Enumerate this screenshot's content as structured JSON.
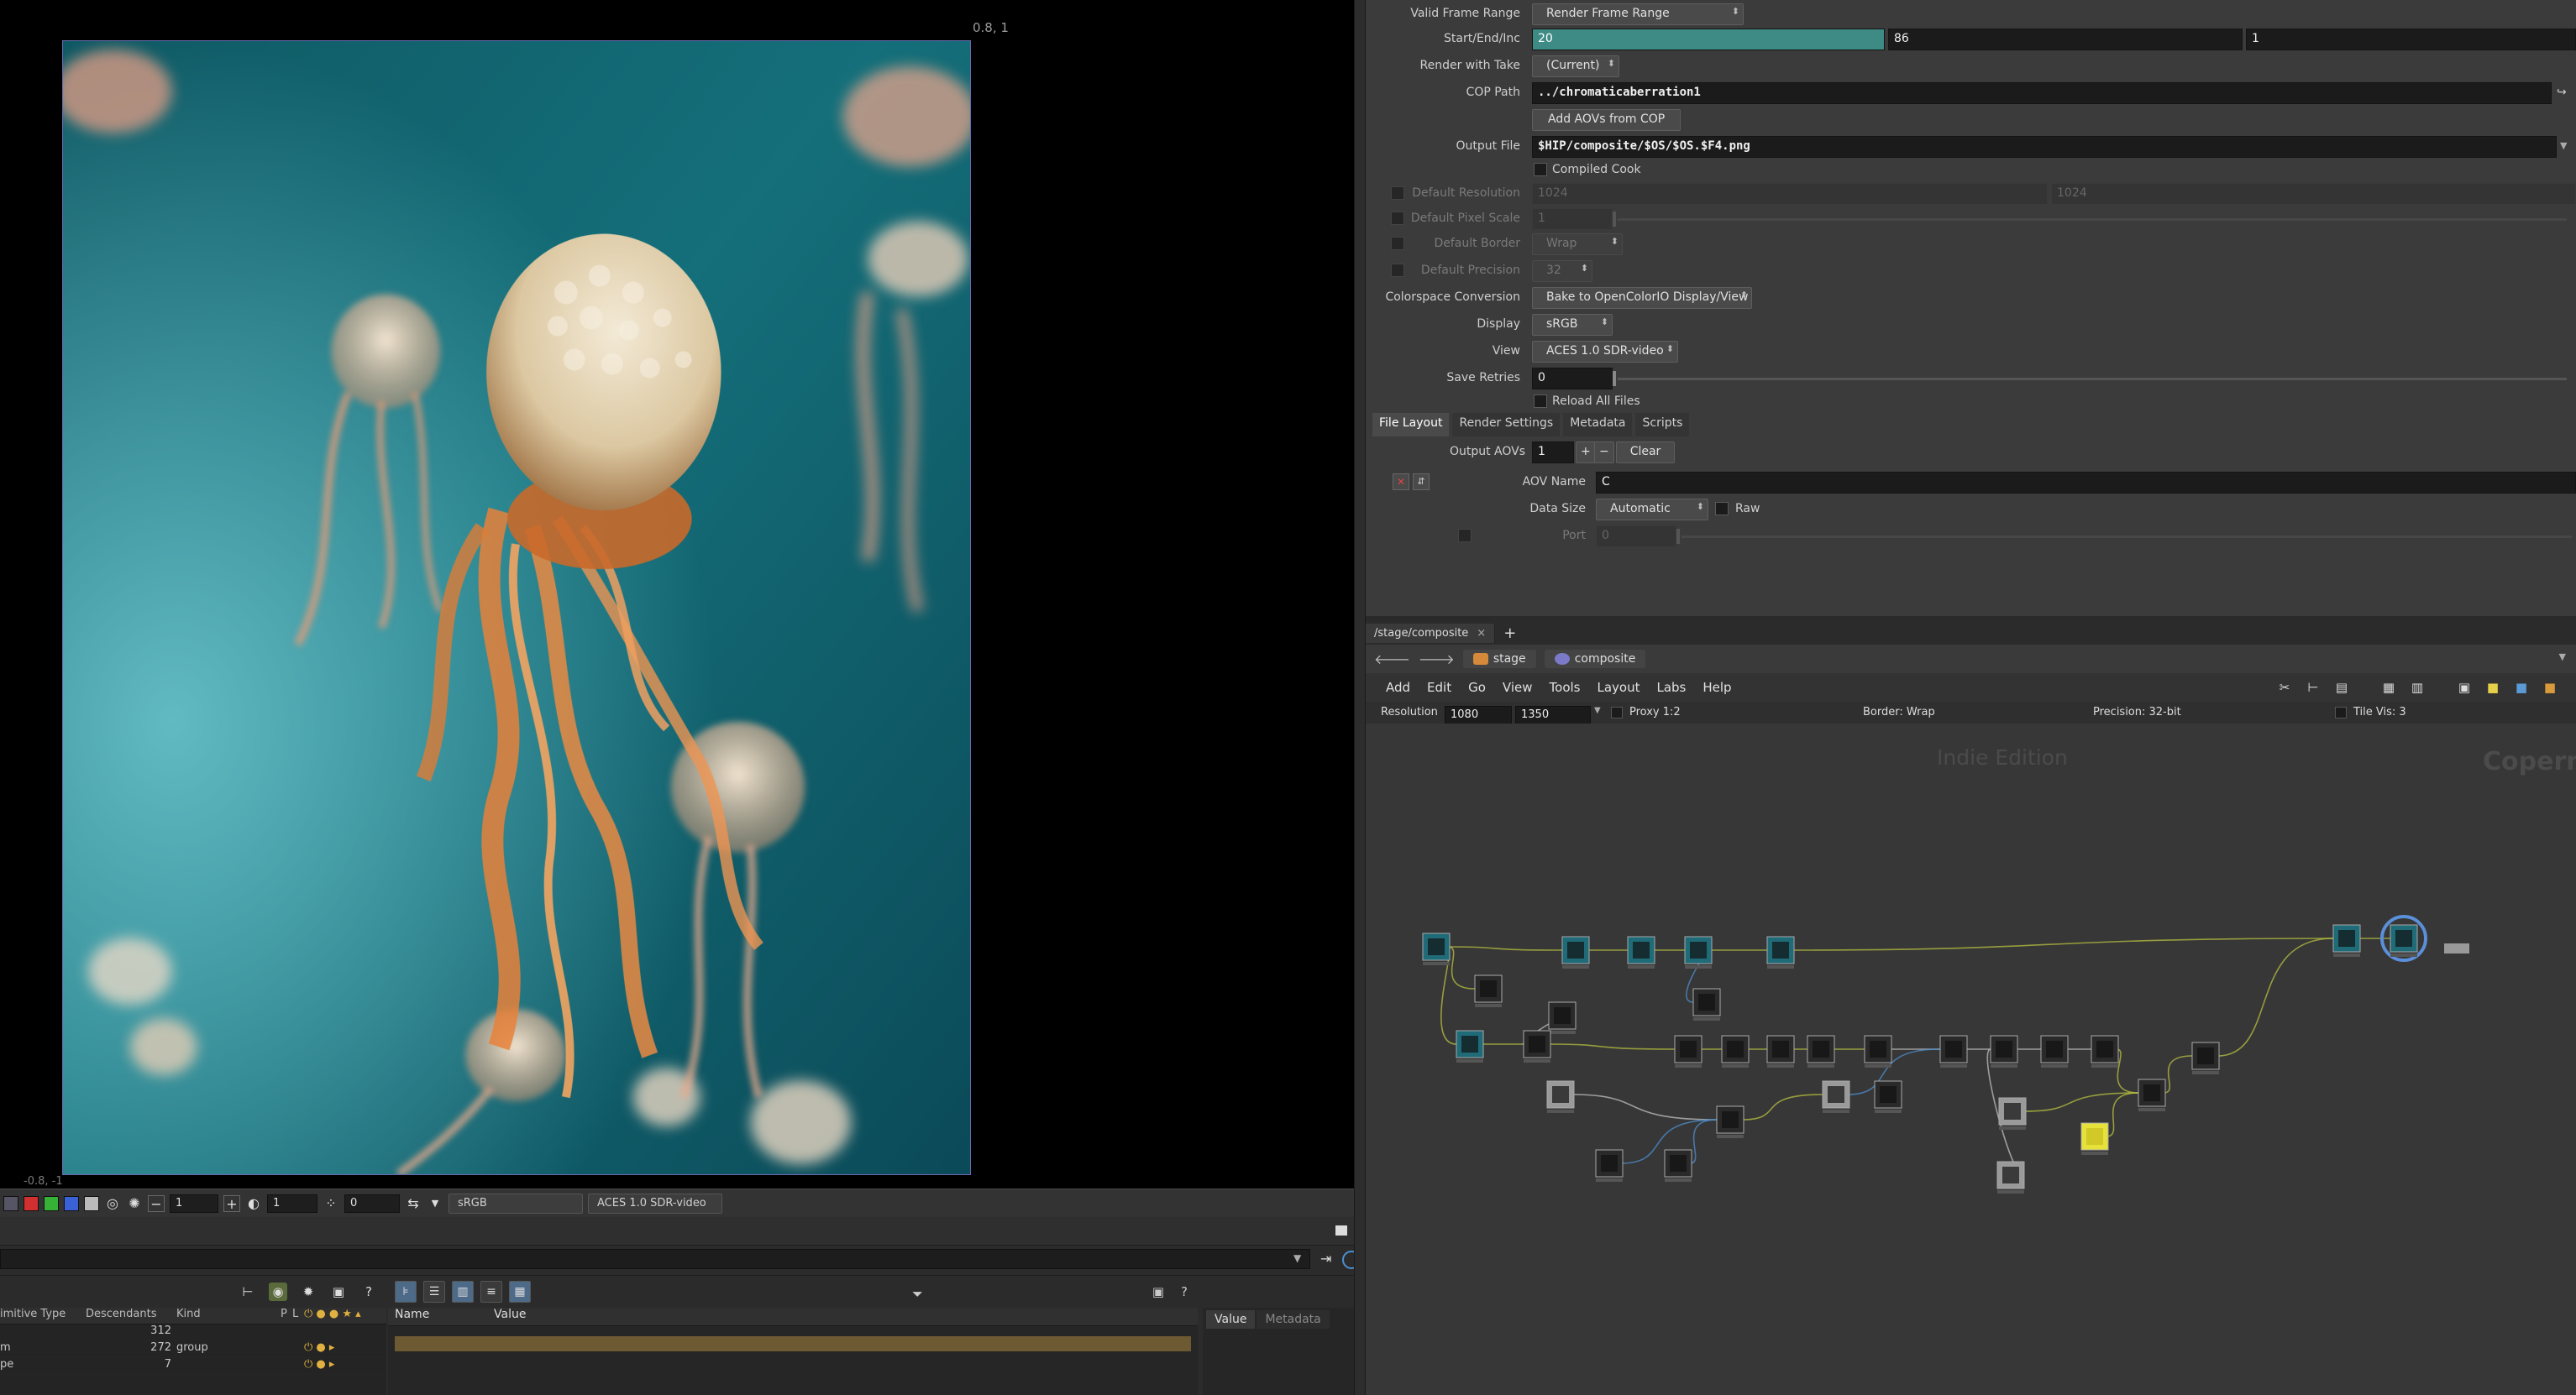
{
  "viewer": {
    "coord_top_right": "0.8, 1",
    "coord_bottom_left": "-0.8, -1",
    "toolbar": {
      "field1": "1",
      "field2": "1",
      "field3": "0",
      "display_combo": "sRGB",
      "view_combo": "ACES 1.0 SDR-video"
    }
  },
  "scene_graph": {
    "columns": [
      "imitive Type",
      "Descendants",
      "Kind",
      "P",
      "L"
    ],
    "rows": [
      {
        "name": "",
        "descendants": "312",
        "kind": ""
      },
      {
        "name": "m",
        "descendants": "272",
        "kind": "group"
      },
      {
        "name": "pe",
        "descendants": "7",
        "kind": ""
      }
    ]
  },
  "attributes": {
    "columns": [
      "Name",
      "Value"
    ]
  },
  "value_pane": {
    "tabs": [
      "Value",
      "Metadata"
    ]
  },
  "params": {
    "valid_frame_range": {
      "label": "Valid Frame Range",
      "value": "Render Frame Range"
    },
    "start_end_inc": {
      "label": "Start/End/Inc",
      "start": "20",
      "end": "86",
      "inc": "1"
    },
    "render_with_take": {
      "label": "Render with Take",
      "value": "(Current)"
    },
    "cop_path": {
      "label": "COP Path",
      "value": "../chromaticaberration1"
    },
    "add_aovs_button": "Add AOVs from COP",
    "output_file": {
      "label": "Output File",
      "value": "$HIP/composite/$OS/$OS.$F4.png"
    },
    "compiled_cook": "Compiled Cook",
    "default_resolution": {
      "label": "Default Resolution",
      "w": "1024",
      "h": "1024"
    },
    "default_pixel_scale": {
      "label": "Default Pixel Scale",
      "value": "1"
    },
    "default_border": {
      "label": "Default Border",
      "value": "Wrap"
    },
    "default_precision": {
      "label": "Default Precision",
      "value": "32"
    },
    "colorspace_conversion": {
      "label": "Colorspace Conversion",
      "value": "Bake to OpenColorIO Display/View"
    },
    "display": {
      "label": "Display",
      "value": "sRGB"
    },
    "view": {
      "label": "View",
      "value": "ACES 1.0 SDR-video"
    },
    "save_retries": {
      "label": "Save Retries",
      "value": "0"
    },
    "reload_all_files": "Reload All Files",
    "tabs": [
      "File Layout",
      "Render Settings",
      "Metadata",
      "Scripts"
    ],
    "output_aovs": {
      "label": "Output AOVs",
      "value": "1",
      "clear": "Clear"
    },
    "aov_name": {
      "label": "AOV Name",
      "value": "C"
    },
    "data_size": {
      "label": "Data Size",
      "value": "Automatic",
      "raw": "Raw"
    },
    "port": {
      "label": "Port",
      "value": "0"
    }
  },
  "network": {
    "tab_label": "/stage/composite",
    "crumbs": [
      "stage",
      "composite"
    ],
    "menu": [
      "Add",
      "Edit",
      "Go",
      "View",
      "Tools",
      "Layout",
      "Labs",
      "Help"
    ],
    "info": {
      "resolution_label": "Resolution",
      "res_w": "1080",
      "res_h": "1350",
      "proxy": "Proxy 1:2",
      "border": "Border: Wrap",
      "precision": "Precision: 32-bit",
      "tile_vis": "Tile Vis: 3"
    },
    "watermark_edition": "Indie Edition",
    "watermark_context": "Copernicus"
  },
  "colors": {
    "accent_teal": "#3e8b86",
    "node_highlight": "#5b8fd9",
    "yellow_node": "#e6e23a"
  }
}
